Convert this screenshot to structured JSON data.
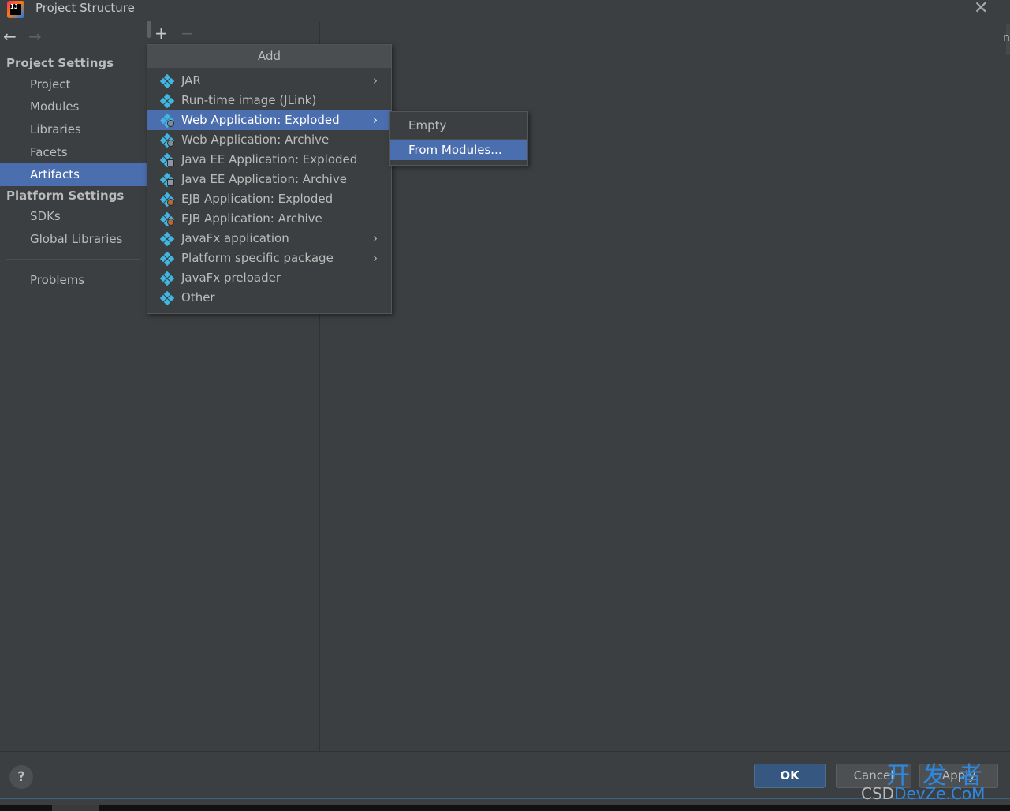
{
  "window": {
    "title": "Project Structure",
    "logo_text": "IJ",
    "close_glyph": "✕"
  },
  "nav": {
    "back_glyph": "←",
    "forward_glyph": "→"
  },
  "sidebar": {
    "project_settings_header": "Project Settings",
    "project_items": [
      {
        "label": "Project"
      },
      {
        "label": "Modules"
      },
      {
        "label": "Libraries"
      },
      {
        "label": "Facets"
      },
      {
        "label": "Artifacts",
        "selected": true
      }
    ],
    "platform_settings_header": "Platform Settings",
    "platform_items": [
      {
        "label": "SDKs"
      },
      {
        "label": "Global Libraries"
      }
    ],
    "problems_label": "Problems"
  },
  "artifacts_toolbar": {
    "add_glyph": "+",
    "remove_glyph": "−"
  },
  "content": {
    "edge_text": "n"
  },
  "add_popup": {
    "header": "Add",
    "items": [
      {
        "label": "JAR",
        "submenu": true,
        "badge": "none"
      },
      {
        "label": "Run-time image (JLink)",
        "submenu": false,
        "badge": "none"
      },
      {
        "label": "Web Application: Exploded",
        "submenu": true,
        "badge": "web",
        "selected": true
      },
      {
        "label": "Web Application: Archive",
        "submenu": false,
        "badge": "web"
      },
      {
        "label": "Java EE Application: Exploded",
        "submenu": false,
        "badge": "ee"
      },
      {
        "label": "Java EE Application: Archive",
        "submenu": false,
        "badge": "ee"
      },
      {
        "label": "EJB Application: Exploded",
        "submenu": false,
        "badge": "ejb"
      },
      {
        "label": "EJB Application: Archive",
        "submenu": false,
        "badge": "ejb"
      },
      {
        "label": "JavaFx application",
        "submenu": true,
        "badge": "none"
      },
      {
        "label": "Platform specific package",
        "submenu": true,
        "badge": "none"
      },
      {
        "label": "JavaFx preloader",
        "submenu": false,
        "badge": "none"
      },
      {
        "label": "Other",
        "submenu": false,
        "badge": "none"
      }
    ],
    "chevron_glyph": "›"
  },
  "submenu": {
    "items": [
      {
        "label": "Empty"
      },
      {
        "label": "From Modules...",
        "selected": true
      }
    ]
  },
  "footer": {
    "help_glyph": "?",
    "ok_label": "OK",
    "cancel_label": "Cancel",
    "apply_label": "Apply"
  },
  "watermark": {
    "cn_text": "开发者",
    "csd_text": "CSD",
    "en_text": "DevZe.CoM"
  },
  "colors": {
    "background": "#3c3f41",
    "selection": "#4b6eaf",
    "primary_button": "#365880",
    "artifact_icon": "#40b6e0",
    "watermark": "#2f88e0"
  }
}
